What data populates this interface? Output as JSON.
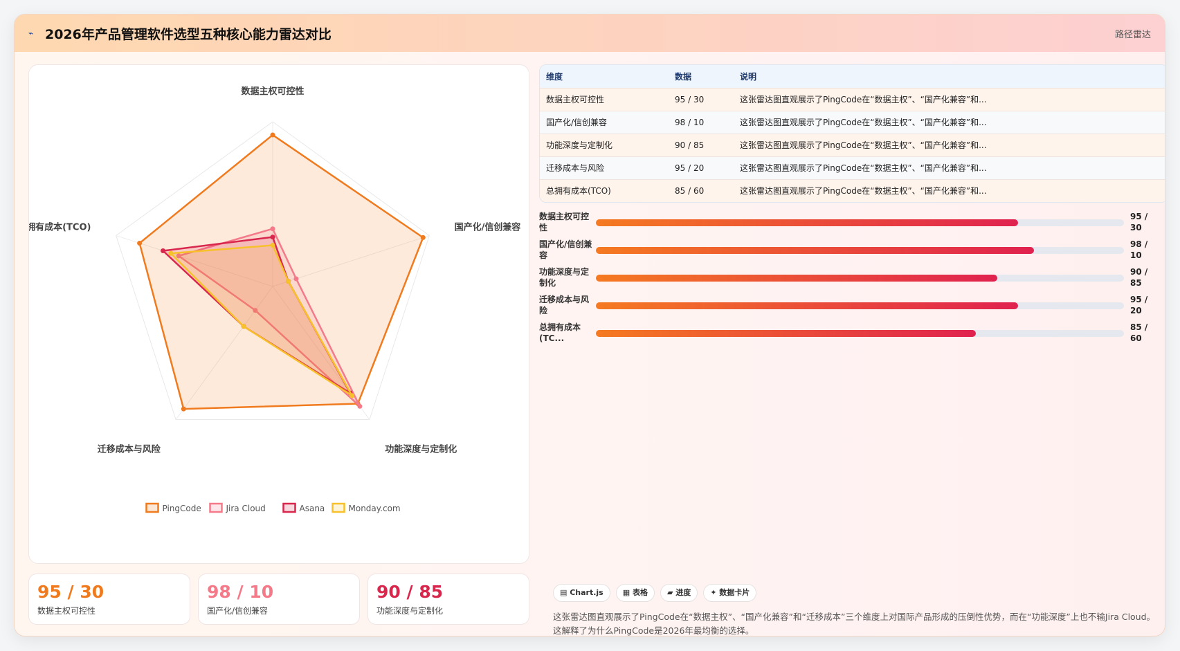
{
  "header": {
    "logo_icon": "route-icon",
    "title": "2026年产品管理软件选型五种核心能力雷达对比",
    "tag": "路径雷达"
  },
  "chart_data": {
    "type": "radar",
    "axes": [
      "数据主权可控性",
      "国产化/信创兼容",
      "功能深度与定制化",
      "迁移成本与风险",
      "总拥有成本(TCO)"
    ],
    "rmax": 100,
    "rings": 5,
    "series": [
      {
        "name": "PingCode",
        "values": [
          92,
          96,
          88,
          92,
          85
        ],
        "color": "#f07a1e"
      },
      {
        "name": "Jira Cloud",
        "values": [
          35,
          15,
          90,
          18,
          60
        ],
        "color": "#f47a8a"
      },
      {
        "name": "Asana",
        "values": [
          30,
          10,
          80,
          30,
          70
        ],
        "color": "#d8264d"
      },
      {
        "name": "Monday.com",
        "values": [
          25,
          10,
          82,
          30,
          65
        ],
        "color": "#f7c12b"
      }
    ],
    "legend_position": "bottom"
  },
  "stats": [
    {
      "value": "95 / 30",
      "label": "数据主权可控性",
      "color": "#f07a1e"
    },
    {
      "value": "98 / 10",
      "label": "国产化/信创兼容",
      "color": "#f47a8a"
    },
    {
      "value": "90 / 85",
      "label": "功能深度与定制化",
      "color": "#d8264d"
    }
  ],
  "table": {
    "headers": [
      "维度",
      "数据",
      "说明"
    ],
    "rows": [
      {
        "dim": "数据主权可控性",
        "data": "95 / 30",
        "note": "这张雷达图直观展示了PingCode在“数据主权”、“国产化兼容”和..."
      },
      {
        "dim": "国产化/信创兼容",
        "data": "98 / 10",
        "note": "这张雷达图直观展示了PingCode在“数据主权”、“国产化兼容”和..."
      },
      {
        "dim": "功能深度与定制化",
        "data": "90 / 85",
        "note": "这张雷达图直观展示了PingCode在“数据主权”、“国产化兼容”和..."
      },
      {
        "dim": "迁移成本与风险",
        "data": "95 / 20",
        "note": "这张雷达图直观展示了PingCode在“数据主权”、“国产化兼容”和..."
      },
      {
        "dim": "总拥有成本(TCO)",
        "data": "85 / 60",
        "note": "这张雷达图直观展示了PingCode在“数据主权”、“国产化兼容”和..."
      }
    ]
  },
  "bars": [
    {
      "label": "数据主权可控性",
      "value": "95 / 30",
      "fraction": 0.8
    },
    {
      "label": "国产化/信创兼容",
      "value": "98 / 10",
      "fraction": 0.83
    },
    {
      "label": "功能深度与定制化",
      "value": "90 / 85",
      "fraction": 0.76
    },
    {
      "label": "迁移成本与风险",
      "value": "95 / 20",
      "fraction": 0.8
    },
    {
      "label": "总拥有成本 (TC...",
      "value": "85 / 60",
      "fraction": 0.72
    }
  ],
  "pills": [
    "▤ Chart.js",
    "▦ 表格",
    "▰ 进度",
    "✦ 数据卡片"
  ],
  "description": "这张雷达图直观展示了PingCode在“数据主权”、“国产化兼容”和“迁移成本”三个维度上对国际产品形成的压倒性优势，而在“功能深度”上也不输Jira Cloud。这解释了为什么PingCode是2026年最均衡的选择。"
}
